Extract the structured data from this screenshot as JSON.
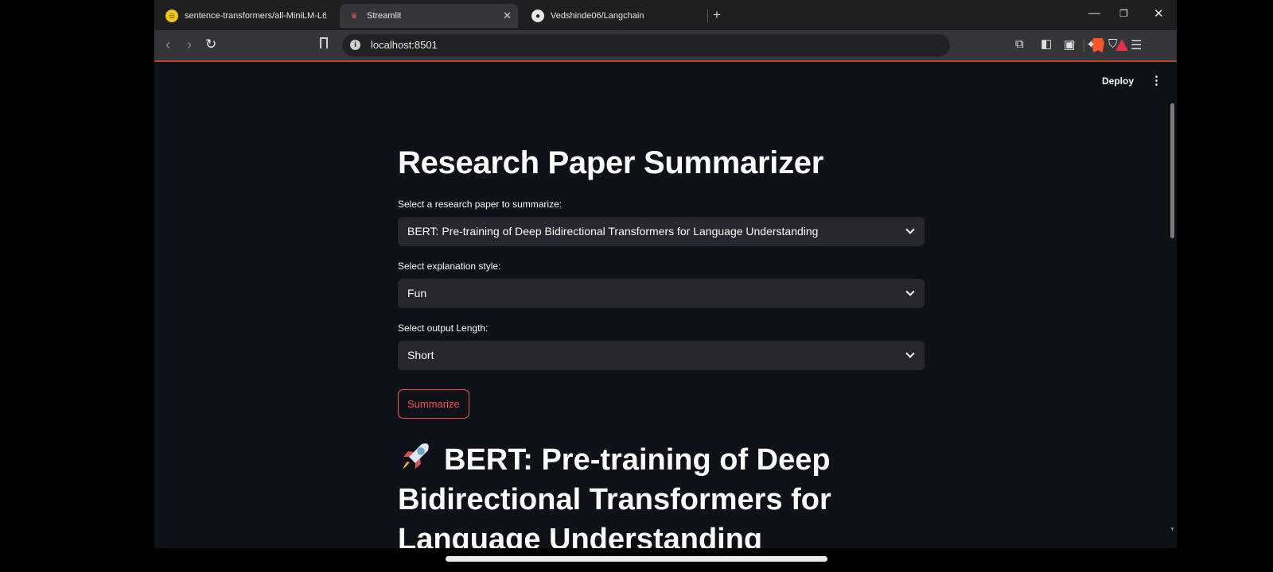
{
  "browser": {
    "tabs": [
      {
        "title": "sentence-transformers/all-MiniLM-L6",
        "icon": "hugging-face-icon"
      },
      {
        "title": "Streamlit",
        "icon": "streamlit-icon",
        "active": true
      },
      {
        "title": "Vedshinde06/Langchain",
        "icon": "github-icon"
      }
    ],
    "new_tab": "+",
    "url": "localhost:8501"
  },
  "app": {
    "deploy_label": "Deploy",
    "menu_icon": "⋮",
    "title": "Research Paper Summarizer",
    "paper_label": "Select a research paper to summarize:",
    "paper_value": "BERT: Pre-training of Deep Bidirectional Transformers for Language Understanding",
    "style_label": "Select explanation style:",
    "style_value": "Fun",
    "length_label": "Select output Length:",
    "length_value": "Short",
    "summarize_label": "Summarize",
    "result_heading": "BERT: Pre-training of Deep Bidirectional Transformers for Language Understanding",
    "result_emoji": "rocket-icon"
  },
  "colors": {
    "background": "#0e1117",
    "widget": "#262730",
    "accent": "#ff4b4b"
  }
}
